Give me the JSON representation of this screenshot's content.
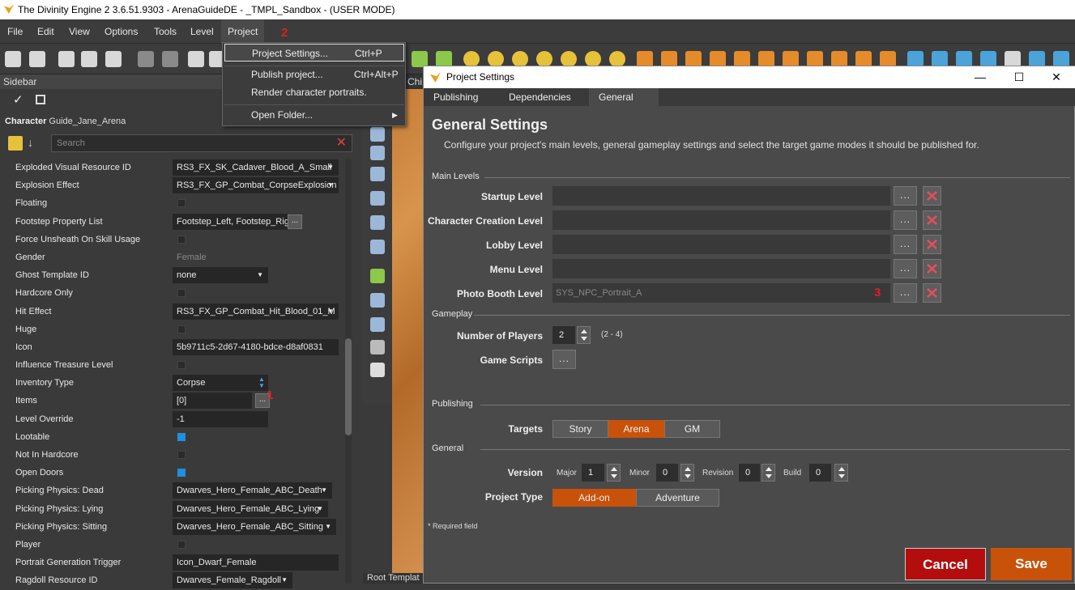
{
  "window": {
    "title": "The Divinity Engine 2 3.6.51.9303 - ArenaGuideDE - _TMPL_Sandbox - (USER MODE)"
  },
  "menu": {
    "items": [
      "File",
      "Edit",
      "View",
      "Options",
      "Tools",
      "Level",
      "Project"
    ],
    "annotation": "2"
  },
  "project_menu": {
    "items": [
      {
        "label": "Project Settings...",
        "shortcut": "Ctrl+P"
      },
      {
        "label": "Publish project...",
        "shortcut": "Ctrl+Alt+P"
      },
      {
        "label": "Render character portraits.",
        "shortcut": ""
      },
      {
        "label": "Open Folder...",
        "shortcut": ""
      }
    ]
  },
  "sidebar": {
    "title": "Sidebar",
    "character_label": "Character",
    "character_name": "Guide_Jane_Arena",
    "search_placeholder": "Search",
    "annotation": "1",
    "properties": [
      {
        "label": "Exploded Visual Resource ID",
        "value": "RS3_FX_SK_Cadaver_Blood_A_Small"
      },
      {
        "label": "Explosion Effect",
        "value": "RS3_FX_GP_Combat_CorpseExplosion"
      },
      {
        "label": "Floating",
        "checked": false
      },
      {
        "label": "Footstep Property List",
        "value": "Footstep_Left, Footstep_Right"
      },
      {
        "label": "Force Unsheath On Skill Usage",
        "checked": false
      },
      {
        "label": "Gender",
        "value": "Female"
      },
      {
        "label": "Ghost Template ID",
        "value": "none"
      },
      {
        "label": "Hardcore Only",
        "checked": false
      },
      {
        "label": "Hit Effect",
        "value": "RS3_FX_GP_Combat_Hit_Blood_01_M"
      },
      {
        "label": "Huge",
        "checked": false
      },
      {
        "label": "Icon",
        "value": "5b9711c5-2d67-4180-bdce-d8af0831"
      },
      {
        "label": "Influence Treasure Level",
        "checked": false
      },
      {
        "label": "Inventory Type",
        "value": "Corpse"
      },
      {
        "label": "Items",
        "value": "[0]"
      },
      {
        "label": "Level Override",
        "value": "-1"
      },
      {
        "label": "Lootable",
        "checked": true
      },
      {
        "label": "Not In Hardcore",
        "checked": false
      },
      {
        "label": "Open Doors",
        "checked": true
      },
      {
        "label": "Picking Physics: Dead",
        "value": "Dwarves_Hero_Female_ABC_Death"
      },
      {
        "label": "Picking Physics: Lying",
        "value": "Dwarves_Hero_Female_ABC_Lying"
      },
      {
        "label": "Picking Physics: Sitting",
        "value": "Dwarves_Hero_Female_ABC_Sitting"
      },
      {
        "label": "Player",
        "checked": false
      },
      {
        "label": "Portrait Generation Trigger",
        "value": "Icon_Dwarf_Female"
      },
      {
        "label": "Ragdoll Resource ID",
        "value": "Dwarves_Female_Ragdoll"
      }
    ]
  },
  "tabs_behind": {
    "chi": "Chi",
    "root": "Root Templat"
  },
  "dialog": {
    "title": "Project Settings",
    "tabs": [
      "Publishing",
      "Dependencies",
      "General"
    ],
    "heading": "General Settings",
    "description": "Configure your project's main levels, general gameplay settings and select the target game modes it should be published for.",
    "sections": {
      "main_levels": "Main Levels",
      "gameplay": "Gameplay",
      "publishing": "Publishing",
      "general": "General"
    },
    "levels": [
      {
        "label": "Startup Level",
        "value": ""
      },
      {
        "label": "Character Creation Level",
        "value": ""
      },
      {
        "label": "Lobby Level",
        "value": ""
      },
      {
        "label": "Menu Level",
        "value": ""
      },
      {
        "label": "Photo Booth Level",
        "value": "SYS_NPC_Portrait_A"
      }
    ],
    "annotation": "3",
    "dots": "...",
    "num_players": {
      "label": "Number of Players",
      "value": "2",
      "range": "(2 - 4)"
    },
    "game_scripts": {
      "label": "Game Scripts"
    },
    "targets": {
      "label": "Targets",
      "options": [
        "Story",
        "Arena",
        "GM"
      ],
      "selected": "Arena"
    },
    "version": {
      "label": "Version",
      "major_label": "Major",
      "major": "1",
      "minor_label": "Minor",
      "minor": "0",
      "revision_label": "Revision",
      "revision": "0",
      "build_label": "Build",
      "build": "0"
    },
    "project_type": {
      "label": "Project Type",
      "options": [
        "Add-on",
        "Adventure"
      ],
      "selected": "Add-on"
    },
    "required_note": "* Required field",
    "cancel": "Cancel",
    "save": "Save",
    "colors": {
      "accent": "#c9520a",
      "cancel": "#b30d0d"
    }
  }
}
